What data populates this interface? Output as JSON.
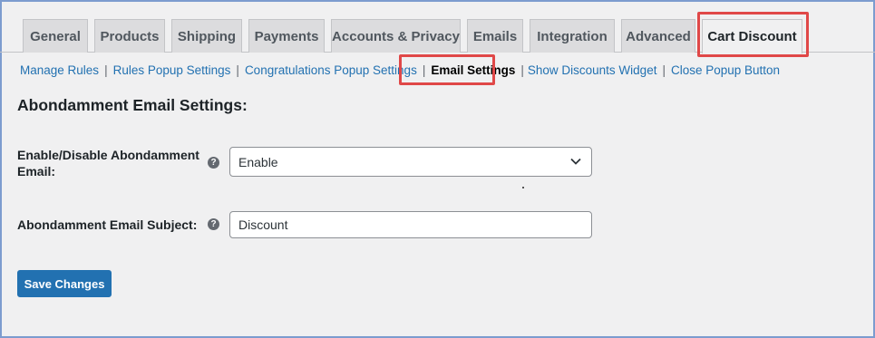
{
  "tabs": [
    {
      "label": "General"
    },
    {
      "label": "Products"
    },
    {
      "label": "Shipping"
    },
    {
      "label": "Payments"
    },
    {
      "label": "Accounts & Privacy"
    },
    {
      "label": "Emails"
    },
    {
      "label": "Integration"
    },
    {
      "label": "Advanced"
    },
    {
      "label": "Cart Discount",
      "active": true
    }
  ],
  "subnav": [
    {
      "label": "Manage Rules"
    },
    {
      "label": "Rules Popup Settings"
    },
    {
      "label": "Congratulations Popup Settings"
    },
    {
      "label": "Email Settings",
      "current": true
    },
    {
      "label": "Show Discounts Widget"
    },
    {
      "label": "Close Popup Button"
    }
  ],
  "separator": "|",
  "section_title": "Abondamment Email Settings:",
  "fields": {
    "enable": {
      "label_line1": "Enable/Disable Abondamment",
      "label_line2": "Email:",
      "value": "Enable",
      "help_glyph": "?"
    },
    "subject": {
      "label": "Abondamment Email Subject:",
      "value": "Discount",
      "help_glyph": "?"
    }
  },
  "save_button": "Save Changes",
  "colors": {
    "accent": "#2271b1",
    "highlight": "#e04848",
    "background": "#f0f0f1"
  },
  "icons": {
    "help": "help-icon",
    "dropdown": "chevron-down-icon"
  }
}
